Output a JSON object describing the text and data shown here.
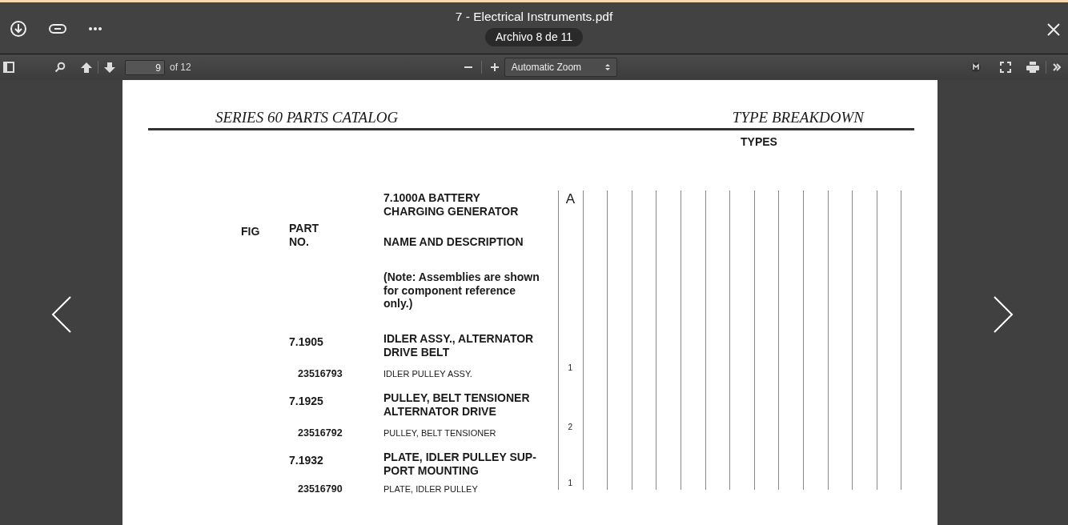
{
  "viewer": {
    "file_title": "7 - Electrical Instruments.pdf",
    "file_counter": "Archivo 8 de 11",
    "page_number": "9",
    "page_count": "of 12",
    "zoom": "Automatic Zoom"
  },
  "document": {
    "header_left": "SERIES 60 PARTS CATALOG",
    "header_right": "TYPE BREAKDOWN",
    "types_label": "TYPES",
    "rows": [
      {
        "kind": "title",
        "desc": "7.1000A BATTERY\nCHARGING GENERATOR",
        "type": "A"
      },
      {
        "kind": "heading",
        "fig": "FIG",
        "part": "PART NO.",
        "desc": "NAME AND DESCRIPTION"
      },
      {
        "kind": "note",
        "desc": "(Note: Assemblies are shown\nfor component reference\nonly.)"
      },
      {
        "kind": "group",
        "part": "7.1905",
        "desc": "IDLER ASSY., ALTERNATOR DRIVE BELT"
      },
      {
        "kind": "part",
        "part": "23516793",
        "desc": "IDLER PULLEY ASSY.",
        "qty": "1"
      },
      {
        "kind": "group",
        "part": "7.1925",
        "desc": "PULLEY, BELT TENSIONER ALTERNATOR DRIVE"
      },
      {
        "kind": "part",
        "part": "23516792",
        "desc": "PULLEY, BELT TENSIONER",
        "qty": "2"
      },
      {
        "kind": "group",
        "part": "7.1932",
        "desc": "PLATE, IDLER PULLEY SUP-PORT MOUNTING"
      },
      {
        "kind": "part",
        "part": "23516790",
        "desc": "PLATE, IDLER PULLEY",
        "qty": "1"
      }
    ]
  }
}
